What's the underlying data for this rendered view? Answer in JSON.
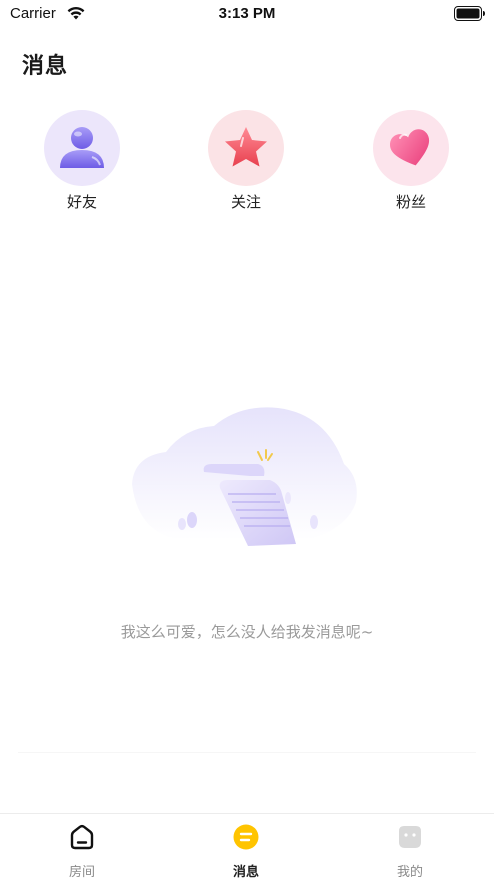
{
  "status_bar": {
    "carrier": "Carrier",
    "time": "3:13 PM"
  },
  "header": {
    "title": "消息"
  },
  "categories": [
    {
      "label": "好友",
      "icon": "person-icon",
      "color": "#8b7cf0"
    },
    {
      "label": "关注",
      "icon": "star-icon",
      "color": "#f06a7a"
    },
    {
      "label": "粉丝",
      "icon": "heart-icon",
      "color": "#f0588a"
    }
  ],
  "empty_state": {
    "message": "我这么可爱，怎么没人给我发消息呢~",
    "icon": "empty-scroll-illustration"
  },
  "tab_bar": {
    "tabs": [
      {
        "label": "房间",
        "icon": "home-icon",
        "active": false
      },
      {
        "label": "消息",
        "icon": "message-icon",
        "active": true
      },
      {
        "label": "我的",
        "icon": "profile-icon",
        "active": false
      }
    ],
    "accent_color": "#ffc400"
  }
}
